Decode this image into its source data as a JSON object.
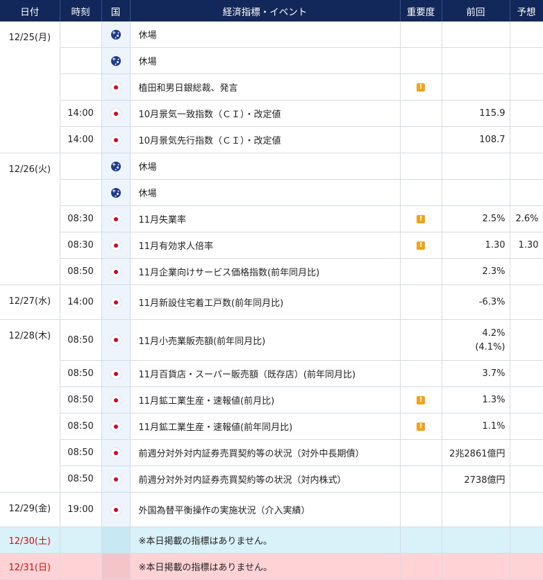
{
  "header": {
    "date": "日付",
    "time": "時刻",
    "country": "国",
    "event": "経済指標・イベント",
    "importance": "重要度",
    "previous": "前回",
    "forecast": "予想"
  },
  "importance_icon": "!",
  "rows": [
    {
      "date": "12/25(月)",
      "time": "",
      "flag": "australia-flag-icon",
      "event": "休場",
      "importance": false,
      "previous": "",
      "previous2": "",
      "forecast": ""
    },
    {
      "date": "",
      "time": "",
      "flag": "australia-flag-icon",
      "event": "休場",
      "importance": false,
      "previous": "",
      "previous2": "",
      "forecast": ""
    },
    {
      "date": "",
      "time": "",
      "flag": "japan-flag-icon",
      "event": "植田和男日銀総裁、発言",
      "importance": true,
      "previous": "",
      "previous2": "",
      "forecast": ""
    },
    {
      "date": "",
      "time": "14:00",
      "flag": "japan-flag-icon",
      "event": "10月景気一致指数（ＣＩ）・改定値",
      "importance": false,
      "previous": "115.9",
      "previous2": "",
      "forecast": ""
    },
    {
      "date": "",
      "time": "14:00",
      "flag": "japan-flag-icon",
      "event": "10月景気先行指数（ＣＩ）・改定値",
      "importance": false,
      "previous": "108.7",
      "previous2": "",
      "forecast": ""
    },
    {
      "date": "12/26(火)",
      "time": "",
      "flag": "australia-flag-icon",
      "event": "休場",
      "importance": false,
      "previous": "",
      "previous2": "",
      "forecast": ""
    },
    {
      "date": "",
      "time": "",
      "flag": "australia-flag-icon",
      "event": "休場",
      "importance": false,
      "previous": "",
      "previous2": "",
      "forecast": ""
    },
    {
      "date": "",
      "time": "08:30",
      "flag": "japan-flag-icon",
      "event": "11月失業率",
      "importance": true,
      "previous": "2.5%",
      "previous2": "",
      "forecast": "2.6%"
    },
    {
      "date": "",
      "time": "08:30",
      "flag": "japan-flag-icon",
      "event": "11月有効求人倍率",
      "importance": true,
      "previous": "1.30",
      "previous2": "",
      "forecast": "1.30"
    },
    {
      "date": "",
      "time": "08:50",
      "flag": "japan-flag-icon",
      "event": "11月企業向けサービス価格指数(前年同月比)",
      "importance": false,
      "previous": "2.3%",
      "previous2": "",
      "forecast": ""
    },
    {
      "date": "12/27(水)",
      "time": "14:00",
      "flag": "japan-flag-icon",
      "event": "11月新設住宅着工戸数(前年同月比)",
      "importance": false,
      "previous": "-6.3%",
      "previous2": "",
      "forecast": ""
    },
    {
      "date": "12/28(木)",
      "time": "08:50",
      "flag": "japan-flag-icon",
      "event": "11月小売業販売額(前年同月比)",
      "importance": false,
      "previous": "4.2%",
      "previous2": "(4.1%)",
      "forecast": ""
    },
    {
      "date": "",
      "time": "08:50",
      "flag": "japan-flag-icon",
      "event": "11月百貨店・スーパー販売額（既存店）(前年同月比)",
      "importance": false,
      "previous": "3.7%",
      "previous2": "",
      "forecast": ""
    },
    {
      "date": "",
      "time": "08:50",
      "flag": "japan-flag-icon",
      "event": "11月鉱工業生産・速報値(前月比)",
      "importance": true,
      "previous": "1.3%",
      "previous2": "",
      "forecast": ""
    },
    {
      "date": "",
      "time": "08:50",
      "flag": "japan-flag-icon",
      "event": "11月鉱工業生産・速報値(前年同月比)",
      "importance": true,
      "previous": "1.1%",
      "previous2": "",
      "forecast": ""
    },
    {
      "date": "",
      "time": "08:50",
      "flag": "japan-flag-icon",
      "event": "前週分対外対内証券売買契約等の状況（対外中長期債）",
      "importance": false,
      "previous": "2兆2861億円",
      "previous2": "",
      "forecast": ""
    },
    {
      "date": "",
      "time": "08:50",
      "flag": "japan-flag-icon",
      "event": "前週分対外対内証券売買契約等の状況（対内株式）",
      "importance": false,
      "previous": "2738億円",
      "previous2": "",
      "forecast": ""
    },
    {
      "date": "12/29(金)",
      "time": "19:00",
      "flag": "japan-flag-icon",
      "event": "外国為替平衡操作の実施状況（介入実績）",
      "importance": false,
      "previous": "",
      "previous2": "",
      "forecast": ""
    },
    {
      "date": "12/30(土)",
      "time": "",
      "flag": "",
      "event": "※本日掲載の指標はありません。",
      "importance": false,
      "previous": "",
      "previous2": "",
      "forecast": "",
      "day": "sat"
    },
    {
      "date": "12/31(日)",
      "time": "",
      "flag": "",
      "event": "※本日掲載の指標はありません。",
      "importance": false,
      "previous": "",
      "previous2": "",
      "forecast": "",
      "day": "sun"
    }
  ]
}
